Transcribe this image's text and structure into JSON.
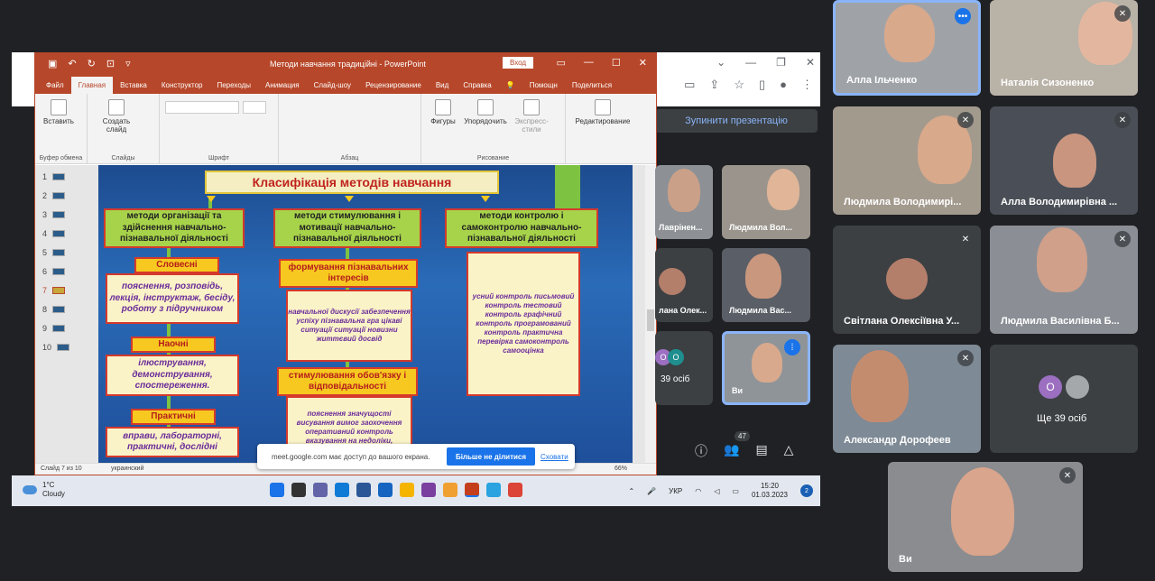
{
  "ppt": {
    "title": "Методи навчання традиційні  -  PowerPoint",
    "signin": "Вход",
    "tabs": [
      "Файл",
      "Главная",
      "Вставка",
      "Конструктор",
      "Переходы",
      "Анимация",
      "Слайд-шоу",
      "Рецензирование",
      "Вид",
      "Справка"
    ],
    "help": "Помощн",
    "share": "Поделиться",
    "ribbon": {
      "paste": "Вставить",
      "clipboard": "Буфер обмена",
      "create_slide": "Создать слайд",
      "slides": "Слайды",
      "font": "Шрифт",
      "paragraph": "Абзац",
      "shapes": "Фигуры",
      "arrange": "Упорядочить",
      "express": "Экспресс-стили",
      "drawing": "Рисование",
      "editing": "Редактирование"
    },
    "thumbs": [
      "1",
      "2",
      "3",
      "4",
      "5",
      "6",
      "7",
      "8",
      "9",
      "10"
    ],
    "status_slide": "Слайд 7 из 10",
    "status_lang": "украинский",
    "zoom": "66%"
  },
  "slide": {
    "title": "Класифікація методів навчання",
    "col1_head": "методи організації та здійснення навчально-пізнавальної діяльності",
    "col2_head": "методи стимулювання і мотивації навчально-пізнавальної діяльності",
    "col3_head": "методи контролю і самоконтролю навчально-пізнавальної діяльності",
    "verbal": "Словесні",
    "verbal_text": "пояснення, розповідь, лекція, інструктаж, бесіду, роботу з підручником",
    "visual": "Наочні",
    "visual_text": "ілюстрування, демонстрування, спостереження.",
    "practical": "Практичні",
    "practical_text": "вправи, лабораторні, практичні, дослідні",
    "interest": "формування пізнавальних інтересів",
    "interest_text": "навчальної дискусії забезпечення успіху пізнавальна гра цікаві ситуації ситуації новизни життєвий досвід",
    "duty": "стимулювання обов'язку і відповідальності",
    "duty_text": "пояснення значущості висування вимог заохочення оперативний контроль вказування на недоліки,",
    "control_text": "усний контроль письмовий контроль тестовий контроль графічний контроль програмований контроль практична перевірка самоконтроль самооцінка"
  },
  "share_notice": {
    "msg": "meet.google.com має доступ до вашого екрана.",
    "stop": "Більше не ділитися",
    "hide": "Сховати"
  },
  "taskbar": {
    "temp": "1°C",
    "weather": "Cloudy",
    "lang": "УКР",
    "time": "15:20",
    "date": "01.03.2023",
    "badge": "2"
  },
  "meet": {
    "stop_presenting": "Зупинити презентацію",
    "people_count": "47",
    "participants": [
      {
        "name": "Алла Ільченко"
      },
      {
        "name": "Наталія Сизоненко"
      },
      {
        "name": "Людмила Володимирі..."
      },
      {
        "name": "Алла Володимирівна ..."
      },
      {
        "name": "Світлана Олексіївна У..."
      },
      {
        "name": "Людмила Василівна Б..."
      },
      {
        "name": "Александр Дорофеев"
      },
      {
        "name": "Ви"
      },
      {
        "name": "Лаврінен..."
      },
      {
        "name": "Людмила Вол..."
      },
      {
        "name": "лана Олек..."
      },
      {
        "name": "Людмила Вас..."
      },
      {
        "name": "Ви"
      }
    ],
    "more_initial": "О",
    "more_small": "39 осіб",
    "more_text": "Ще 39 осіб"
  }
}
